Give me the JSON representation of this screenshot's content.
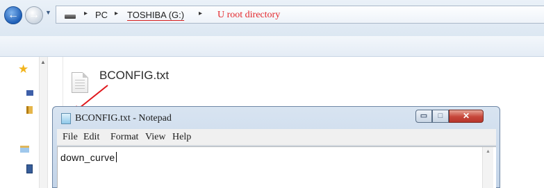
{
  "explorer": {
    "breadcrumbs": [
      "PC",
      "TOSHIBA (G:)"
    ],
    "annotation": "U root directory",
    "file_name": "BCONFIG.txt",
    "icons": {
      "back": "back-arrow-icon",
      "forward": "forward-arrow-icon",
      "favorites": "star-icon",
      "file": "text-file-icon"
    },
    "colors": {
      "annotation": "#e3272b",
      "accent": "#1f5fb7"
    }
  },
  "notepad": {
    "title": "BCONFIG.txt - Notepad",
    "menu": [
      "File",
      "Edit",
      "Format",
      "View",
      "Help"
    ],
    "content": "down_curve",
    "window_buttons": {
      "minimize": "▭",
      "maximize": "□",
      "close": "✕"
    }
  }
}
